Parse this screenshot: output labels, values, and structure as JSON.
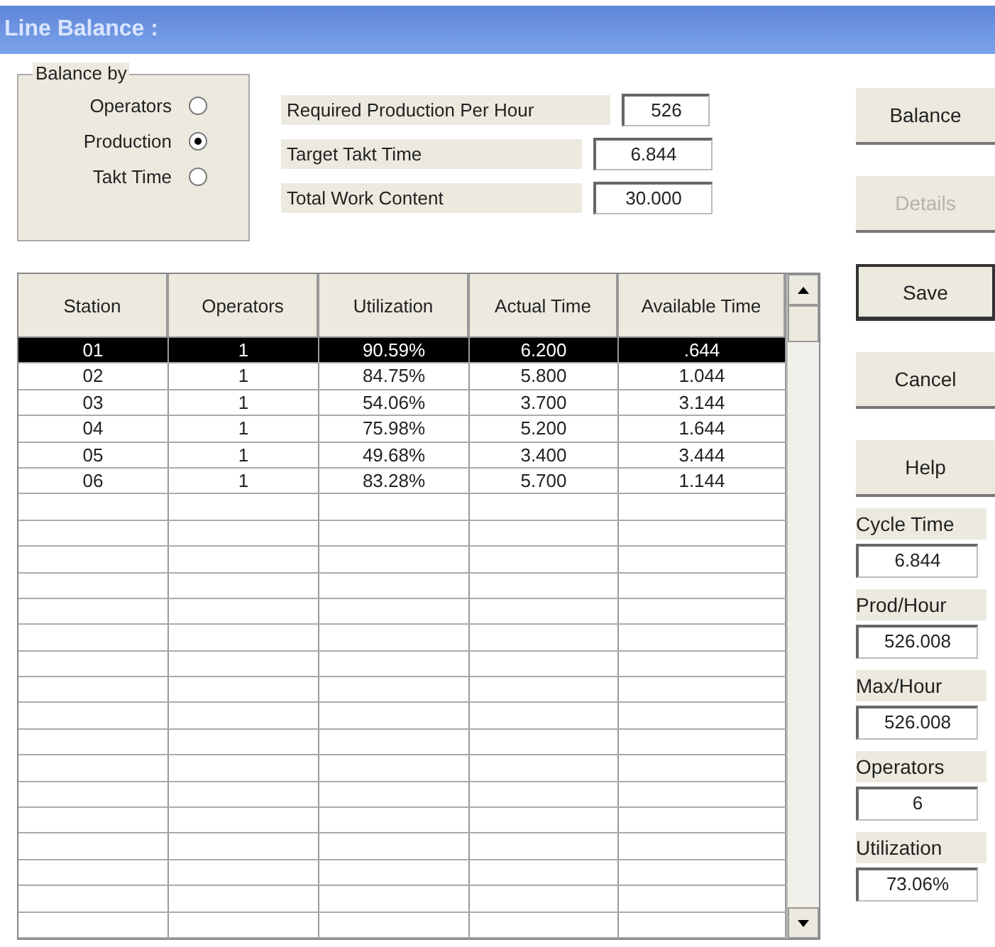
{
  "window": {
    "title": "Line Balance :"
  },
  "balance_by": {
    "legend": "Balance by",
    "options": [
      {
        "label": "Operators",
        "selected": false
      },
      {
        "label": "Production",
        "selected": true
      },
      {
        "label": "Takt Time",
        "selected": false
      }
    ]
  },
  "inputs": [
    {
      "label": "Required Production Per Hour",
      "value": "526"
    },
    {
      "label": "Target Takt Time",
      "value": "6.844"
    },
    {
      "label": "Total Work Content",
      "value": "30.000"
    }
  ],
  "table": {
    "columns": [
      "Station",
      "Operators",
      "Utilization",
      "Actual Time",
      "Available Time"
    ],
    "rows": [
      {
        "cells": [
          "01",
          "1",
          "90.59%",
          "6.200",
          ".644"
        ],
        "selected": true
      },
      {
        "cells": [
          "02",
          "1",
          "84.75%",
          "5.800",
          "1.044"
        ],
        "selected": false
      },
      {
        "cells": [
          "03",
          "1",
          "54.06%",
          "3.700",
          "3.144"
        ],
        "selected": false
      },
      {
        "cells": [
          "04",
          "1",
          "75.98%",
          "5.200",
          "1.644"
        ],
        "selected": false
      },
      {
        "cells": [
          "05",
          "1",
          "49.68%",
          "3.400",
          "3.444"
        ],
        "selected": false
      },
      {
        "cells": [
          "06",
          "1",
          "83.28%",
          "5.700",
          "1.144"
        ],
        "selected": false
      }
    ]
  },
  "buttons": [
    {
      "label": "Balance",
      "disabled": false,
      "default": false
    },
    {
      "label": "Details",
      "disabled": true,
      "default": false
    },
    {
      "label": "Save",
      "disabled": false,
      "default": true
    },
    {
      "label": "Cancel",
      "disabled": false,
      "default": false
    },
    {
      "label": "Help",
      "disabled": false,
      "default": false
    }
  ],
  "summary": [
    {
      "label": "Cycle Time",
      "value": "6.844"
    },
    {
      "label": "Prod/Hour",
      "value": "526.008"
    },
    {
      "label": "Max/Hour",
      "value": "526.008"
    },
    {
      "label": "Operators",
      "value": "6"
    },
    {
      "label": "Utilization",
      "value": "73.06%"
    }
  ]
}
